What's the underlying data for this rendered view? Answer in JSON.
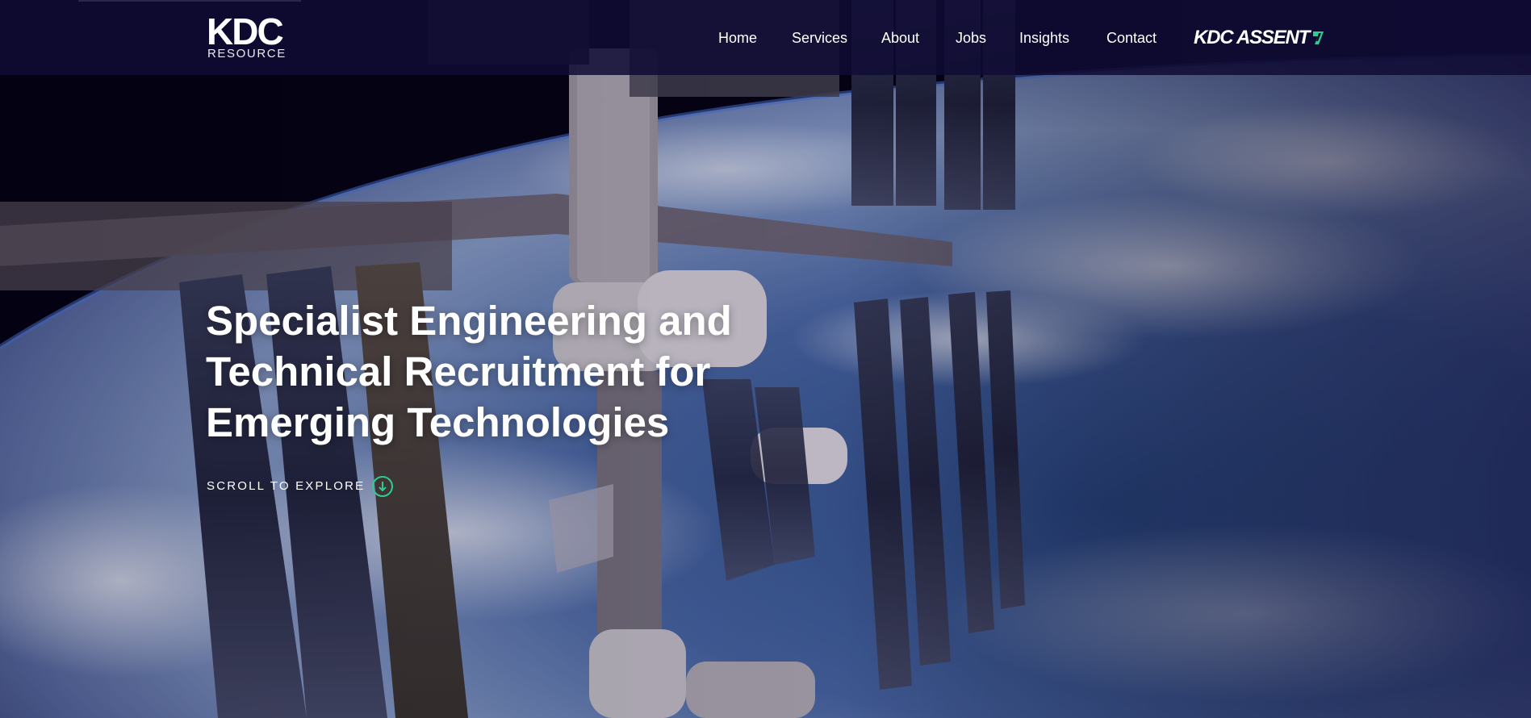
{
  "brand": {
    "logo_main": "KDC",
    "logo_sub": "RESOURCE"
  },
  "nav": {
    "items": [
      {
        "label": "Home"
      },
      {
        "label": "Services"
      },
      {
        "label": "About"
      },
      {
        "label": "Jobs"
      },
      {
        "label": "Insights"
      },
      {
        "label": "Contact"
      }
    ],
    "partner_label": "KDC ASSENT"
  },
  "hero": {
    "headline_lines": [
      "Specialist Engineering and",
      "Technical Recruitment for",
      "Emerging Technologies"
    ],
    "scroll_label": "SCROLL TO EXPLORE",
    "scroll_icon": "scroll-down-circle-icon"
  },
  "colors": {
    "nav_background": "#100c34",
    "accent_green": "#2ecc8f",
    "text": "#ffffff"
  }
}
